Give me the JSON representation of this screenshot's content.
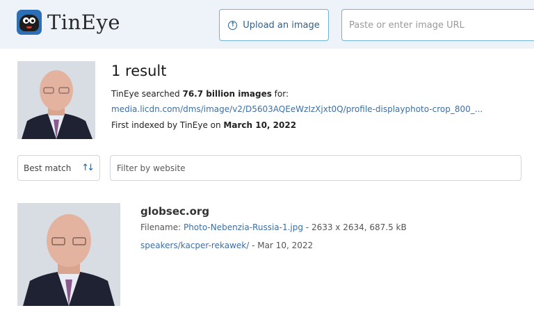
{
  "header": {
    "logo_text": "TinEye",
    "upload_label": "Upload an image",
    "url_placeholder": "Paste or enter image URL"
  },
  "summary": {
    "result_count": "1 result",
    "searched_prefix": "TinEye searched ",
    "searched_amount": "76.7 billion images",
    "searched_suffix": " for:",
    "query_url": "media.licdn.com/dms/image/v2/D5603AQEeWzIzXjxt0Q/profile-displayphoto-crop_800_...",
    "indexed_prefix": "First indexed by TinEye on ",
    "indexed_date": "March 10, 2022"
  },
  "controls": {
    "sort_label": "Best match",
    "filter_placeholder": "Filter by website"
  },
  "match": {
    "domain": "globsec.org",
    "filename_label": "Filename: ",
    "filename": "Photo-Nebenzia-Russia-1.jpg",
    "file_info": " - 2633 x 2634, 687.5 kB",
    "page_link": "speakers/kacper-rekawek/",
    "page_date": " - Mar 10, 2022"
  },
  "colors": {
    "header_bg": "#eef3f9",
    "accent": "#3d6fa3",
    "border": "#6fb3d9"
  },
  "icons": [
    "tineye-logo-icon",
    "upload-icon",
    "sort-icon"
  ]
}
